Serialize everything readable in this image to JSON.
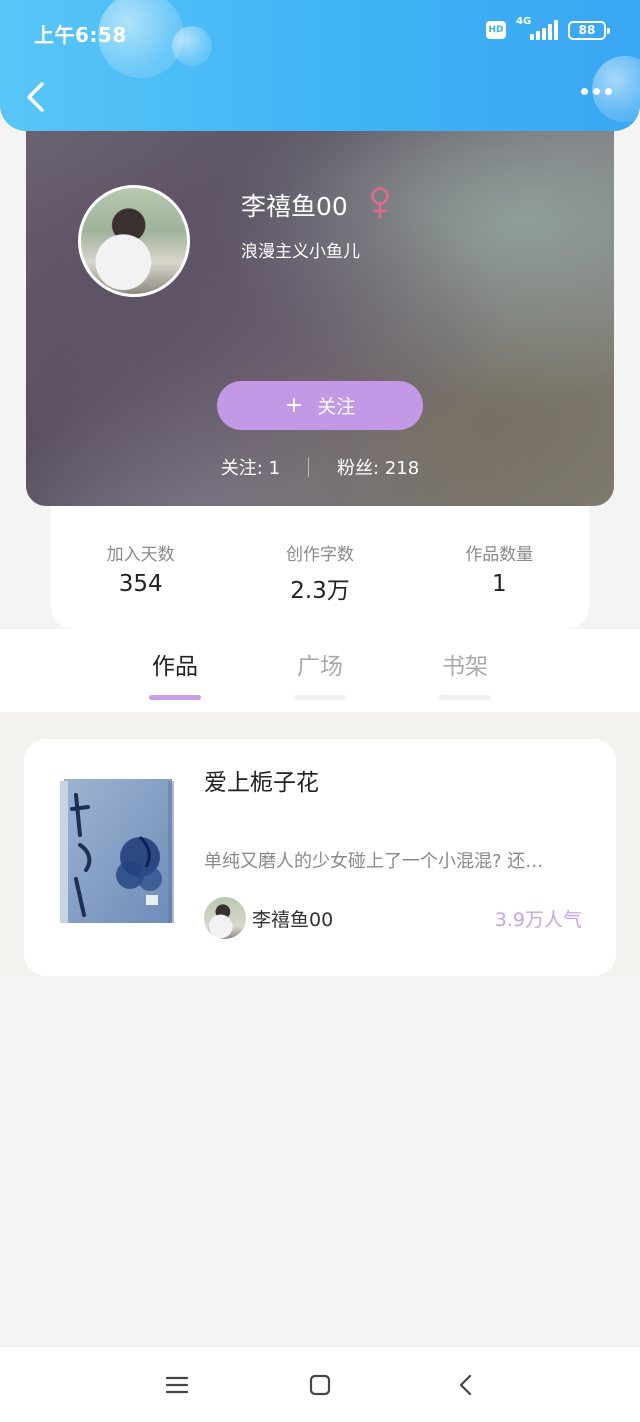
{
  "status_bar": {
    "time": "上午6:58",
    "hd": "HD",
    "network": "4G",
    "battery": "88"
  },
  "profile": {
    "username": "李禧鱼00",
    "gender_icon": "female-icon",
    "bio": "浪漫主义小鱼儿",
    "follow_plus": "+",
    "follow_label": "关注",
    "following_text": "关注: 1",
    "followers_text": "粉丝: 218"
  },
  "stats": [
    {
      "label": "加入天数",
      "value": "354"
    },
    {
      "label": "创作字数",
      "value": "2.3万"
    },
    {
      "label": "作品数量",
      "value": "1"
    }
  ],
  "tabs": [
    {
      "label": "作品",
      "active": true
    },
    {
      "label": "广场",
      "active": false
    },
    {
      "label": "书架",
      "active": false
    }
  ],
  "book": {
    "title": "爱上栀子花",
    "description": "单纯又磨人的少女碰上了一个小混混? 还…",
    "author": "李禧鱼00",
    "popularity": "3.9万人气",
    "cover_lettering": "栀子花"
  },
  "colors": {
    "header": "#3fb3f5",
    "accent": "#c398e6",
    "popularity": "#c9a3e3"
  }
}
